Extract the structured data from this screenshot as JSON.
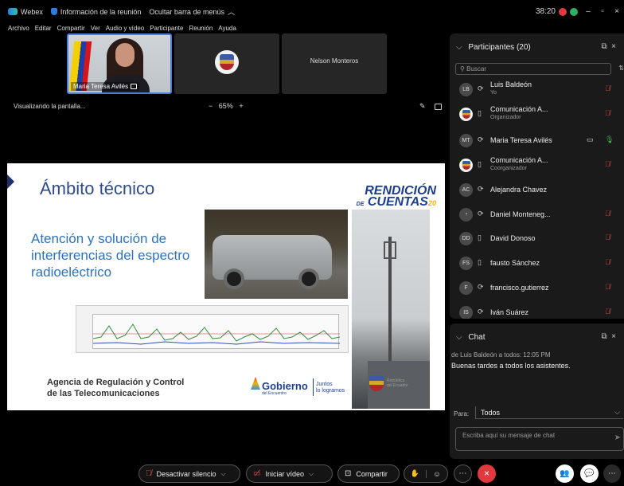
{
  "titlebar": {
    "app_name": "Webex",
    "meeting_info": "Información de la reunión",
    "hide_menu": "Ocultar barra de menús",
    "time": "38:20"
  },
  "menu": [
    "Archivo",
    "Editar",
    "Compartir",
    "Ver",
    "Audio y vídeo",
    "Participante",
    "Reunión",
    "Ayuda"
  ],
  "videos": {
    "tile1_name": "Maria Teresa Avilés",
    "tile3_name": "Nelson Monteros"
  },
  "share": {
    "status": "Visualizando la pantalla...",
    "zoom": "65%",
    "zoom_minus": "−",
    "zoom_plus": "+"
  },
  "slide": {
    "title": "Ámbito técnico",
    "brand_top": "RENDICIÓN",
    "brand_de": "DE",
    "brand_bottom": "CUENTAS",
    "brand_year": "20",
    "subtitle": "Atención y solución de interferencias del espectro radioeléctrico",
    "agency_line1": "Agencia de Regulación y Control",
    "agency_line2": "de las Telecomunicaciones",
    "gob_name": "Gobierno",
    "gob_small": "del Encuentro",
    "gob_slogan1": "Juntos",
    "gob_slogan2": "lo logramos",
    "rep1": "República",
    "rep2": "del Ecuador"
  },
  "participants": {
    "header": "Participantes (20)",
    "search_placeholder": "Buscar",
    "list": [
      {
        "initials": "LB",
        "name": "Luis Baldeón",
        "role": "Yo"
      },
      {
        "initials": "",
        "name": "Comunicación A...",
        "role": "Organizador"
      },
      {
        "initials": "MT",
        "name": "Maria Teresa Avilés",
        "role": ""
      },
      {
        "initials": "",
        "name": "Comunicación A...",
        "role": "Coorganizador"
      },
      {
        "initials": "AC",
        "name": "Alejandra Chavez",
        "role": ""
      },
      {
        "initials": "",
        "name": "Daniel Monteneg...",
        "role": ""
      },
      {
        "initials": "DD",
        "name": "David Donoso",
        "role": ""
      },
      {
        "initials": "FS",
        "name": "fausto Sánchez",
        "role": ""
      },
      {
        "initials": "F",
        "name": "francisco.gutierrez",
        "role": ""
      },
      {
        "initials": "IS",
        "name": "Iván Suárez",
        "role": ""
      }
    ]
  },
  "chat": {
    "header": "Chat",
    "meta": "de Luis Baldeón a todos:  12:05 PM",
    "message": "Buenas tardes a todos los asistentes.",
    "to_label": "Para:",
    "to_value": "Todos",
    "input_placeholder": "Escriba aquí su mensaje de chat"
  },
  "toolbar": {
    "mute": "Desactivar silencio",
    "video": "Iniciar vídeo",
    "share": "Compartir"
  },
  "colors": {
    "accent": "#4a7fd8",
    "leave": "#e0393e",
    "muted_mic": "#e04a4a",
    "active_mic": "#3fb950"
  }
}
